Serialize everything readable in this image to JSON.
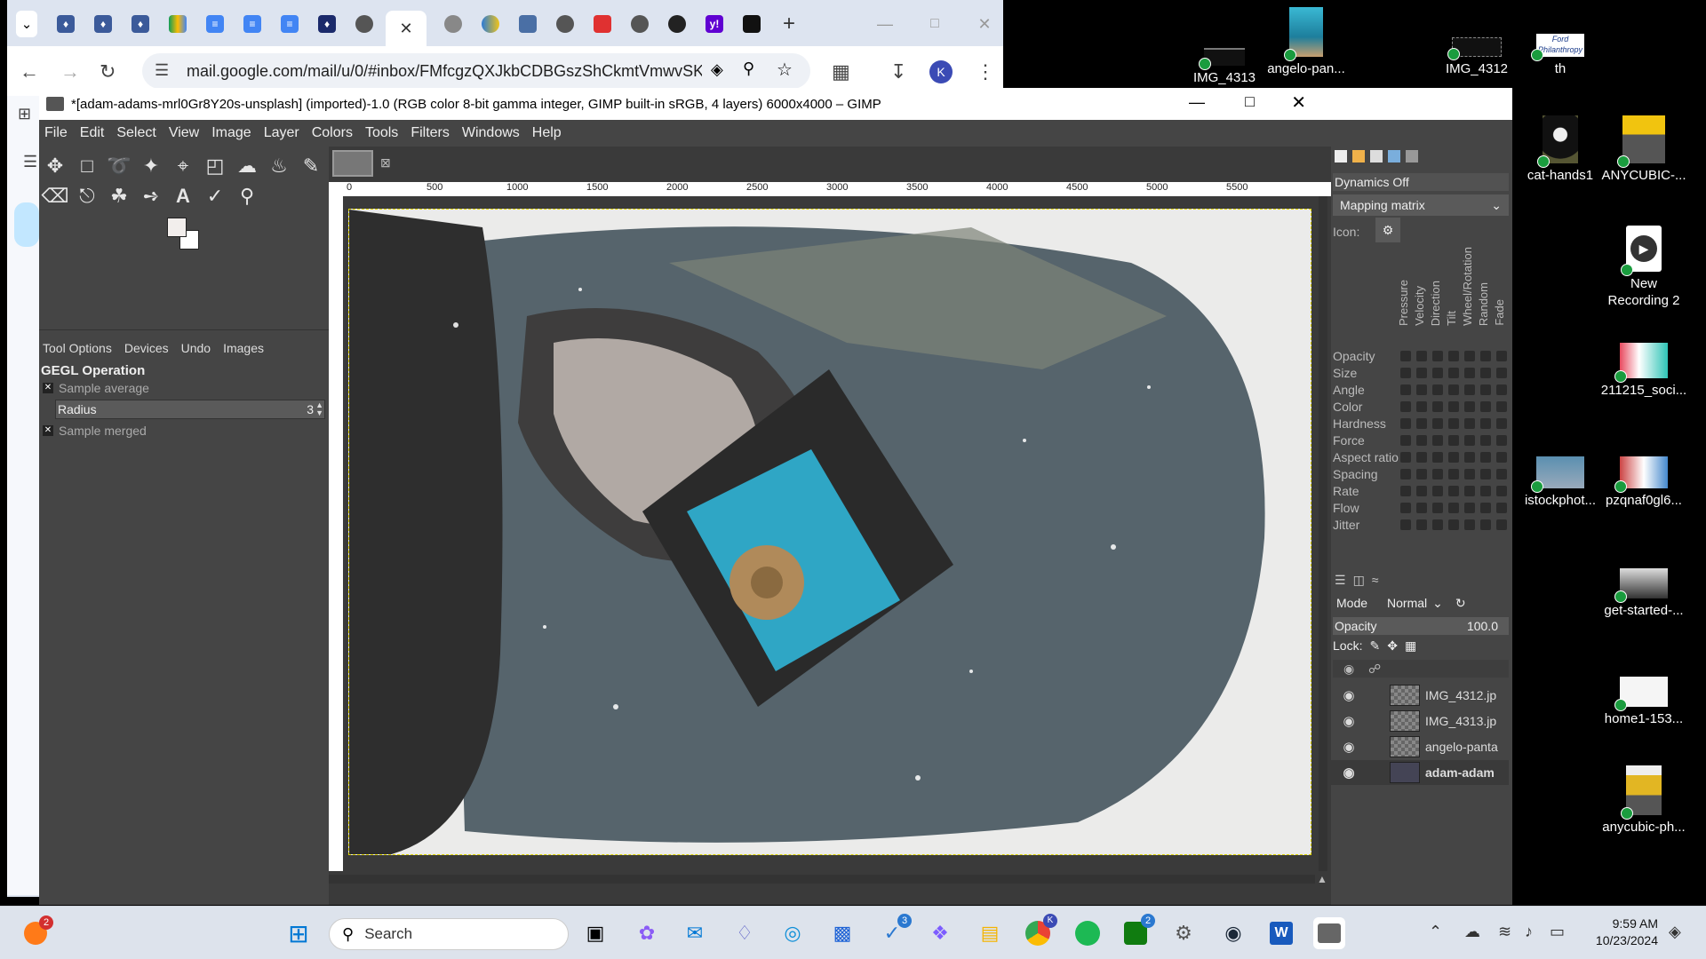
{
  "browser": {
    "url": "mail.google.com/mail/u/0/#inbox/FMfcgzQXJkbCDBGszShCkmtVmwvSK...",
    "profile_initial": "K"
  },
  "gimp": {
    "title": "*[adam-adams-mrl0Gr8Y20s-unsplash] (imported)-1.0 (RGB color 8-bit gamma integer, GIMP built-in sRGB, 4 layers) 6000x4000 – GIMP",
    "menu": [
      "File",
      "Edit",
      "Select",
      "View",
      "Image",
      "Layer",
      "Colors",
      "Tools",
      "Filters",
      "Windows",
      "Help"
    ],
    "dock_tabs": [
      "Tool Options",
      "Devices",
      "Undo",
      "Images"
    ],
    "tool_options": {
      "heading": "GEGL Operation",
      "sample_average": "Sample average",
      "radius_label": "Radius",
      "radius_value": "3",
      "sample_merged": "Sample merged"
    },
    "ruler_ticks": [
      "0",
      "500",
      "1000",
      "1500",
      "2000",
      "2500",
      "3000",
      "3500",
      "4000",
      "4500",
      "5000",
      "5500"
    ],
    "dynamics": {
      "status": "Dynamics Off",
      "mapping": "Mapping matrix",
      "icon_label": "Icon:",
      "columns": [
        "Pressure",
        "Velocity",
        "Direction",
        "Tilt",
        "Wheel/Rotation",
        "Random",
        "Fade"
      ],
      "rows": [
        "Opacity",
        "Size",
        "Angle",
        "Color",
        "Hardness",
        "Force",
        "Aspect ratio",
        "Spacing",
        "Rate",
        "Flow",
        "Jitter"
      ]
    },
    "layers": {
      "mode_label": "Mode",
      "mode_value": "Normal",
      "opacity_label": "Opacity",
      "opacity_value": "100.0",
      "lock_label": "Lock:",
      "items": [
        "IMG_4312.jp",
        "IMG_4313.jp",
        "angelo-panta",
        "adam-adam"
      ]
    }
  },
  "desktop_icons": [
    {
      "label": "IMG_4313"
    },
    {
      "label": "angelo-pan..."
    },
    {
      "label": "IMG_4312"
    },
    {
      "label": "th"
    },
    {
      "label": "cat-hands1"
    },
    {
      "label": "ANYCUBIC-..."
    },
    {
      "label": "New Recording 2"
    },
    {
      "label": "211215_soci..."
    },
    {
      "label": "istockphot..."
    },
    {
      "label": "pzqnaf0gl6..."
    },
    {
      "label": "get-started-..."
    },
    {
      "label": "home1-153..."
    },
    {
      "label": "anycubic-ph..."
    }
  ],
  "taskbar": {
    "search_placeholder": "Search",
    "notification_badge": "2",
    "chrome_badge": "K",
    "xbox_badge": "2",
    "time": "9:59 AM",
    "date": "10/23/2024"
  }
}
